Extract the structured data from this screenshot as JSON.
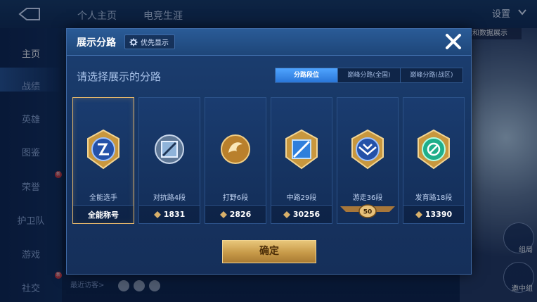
{
  "background": {
    "tabs": [
      "个人主页",
      "电竞生涯"
    ],
    "settings_label": "设置",
    "notice_text": "",
    "banner_text": "定和数据展示",
    "sidebar": [
      {
        "label": "主页",
        "active": true
      },
      {
        "label": "战绩",
        "active": false
      },
      {
        "label": "英雄",
        "active": false
      },
      {
        "label": "图鉴",
        "active": false
      },
      {
        "label": "荣誉",
        "active": false,
        "badge": "新"
      },
      {
        "label": "护卫队",
        "active": false
      },
      {
        "label": "游戏",
        "active": false
      },
      {
        "label": "社交",
        "active": false,
        "badge": "新"
      }
    ],
    "recent_visitors_label": "最近访客>",
    "right_buttons": [
      "组局",
      "邀中组"
    ]
  },
  "modal": {
    "title": "展示分路",
    "priority_label": "优先显示",
    "subtitle": "请选择展示的分路",
    "segments": [
      {
        "label": "分路段位",
        "active": true
      },
      {
        "label": "巅峰分路(全国)",
        "active": false
      },
      {
        "label": "巅峰分路(战区)",
        "active": false
      }
    ],
    "cards": [
      {
        "label": "全能选手",
        "value": "全能称号",
        "selected": true,
        "icon": "all-round-badge-icon",
        "accent": "#4a7fe0"
      },
      {
        "label": "对抗路4段",
        "value": "1831",
        "selected": false,
        "icon": "clash-lane-badge-icon",
        "accent": "#8fa9c9"
      },
      {
        "label": "打野6段",
        "value": "2826",
        "selected": false,
        "icon": "jungle-badge-icon",
        "accent": "#d49a3a"
      },
      {
        "label": "中路29段",
        "value": "30256",
        "selected": false,
        "icon": "mid-lane-badge-icon",
        "accent": "#3a8ee6"
      },
      {
        "label": "游走36段",
        "value": "",
        "streak": "50",
        "selected": false,
        "icon": "roam-badge-icon",
        "accent": "#4a7fe0"
      },
      {
        "label": "发育路18段",
        "value": "13390",
        "selected": false,
        "icon": "farm-lane-badge-icon",
        "accent": "#2fc7a0"
      }
    ],
    "confirm_label": "确定"
  },
  "colors": {
    "gold": "#e0b46b",
    "accent_blue": "#4fa4ff",
    "panel": "#173664"
  }
}
